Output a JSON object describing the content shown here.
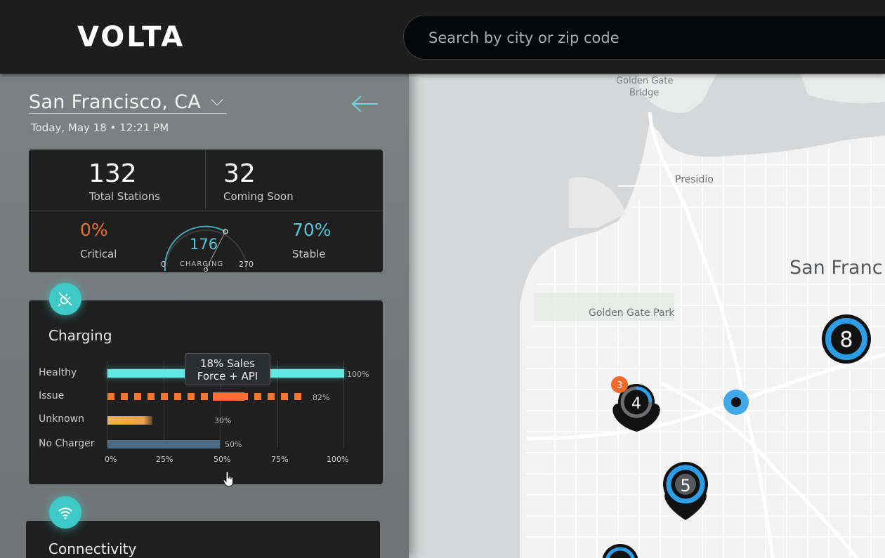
{
  "header": {
    "logo": "VOLTA",
    "search_placeholder": "Search by city or zip code"
  },
  "sidebar": {
    "location": "San Francisco, CA",
    "datetime": "Today, May 18 • 12:21 PM",
    "stats": {
      "total_stations": {
        "value": "132",
        "label": "Total Stations"
      },
      "coming_soon": {
        "value": "32",
        "label": "Coming Soon"
      },
      "critical": {
        "value": "0%",
        "label": "Critical"
      },
      "stable": {
        "value": "70%",
        "label": "Stable"
      },
      "charging_gauge": {
        "value": "176",
        "label": "CHARGING",
        "min": "0",
        "max": "270"
      }
    },
    "charging_card": {
      "title": "Charging",
      "rows": [
        {
          "label": "Healthy",
          "pct": "100%",
          "value": 1.0
        },
        {
          "label": "Issue",
          "pct": "82%",
          "value": 0.82
        },
        {
          "label": "Unknown",
          "pct": "30%",
          "value": 0.3
        },
        {
          "label": "No Charger",
          "pct": "50%",
          "value": 0.5
        }
      ],
      "axis": [
        "0%",
        "25%",
        "50%",
        "75%",
        "100%"
      ],
      "tooltip_line1": "18% Sales",
      "tooltip_line2": "Force + API"
    },
    "connectivity_card": {
      "title": "Connectivity"
    }
  },
  "map": {
    "labels": {
      "golden_gate_bridge_1": "Golden Gate",
      "golden_gate_bridge_2": "Bridge",
      "presidio": "Presidio",
      "golden_gate_park": "Golden Gate Park",
      "city": "San Franc"
    },
    "markers": {
      "pin_4": "4",
      "pin_4_alert": "3",
      "pin_5": "5",
      "cluster_8": "8"
    }
  },
  "colors": {
    "accent_teal": "#4fc8dc",
    "critical_orange": "#f06a2c",
    "marker_blue": "#2d9ee6"
  }
}
